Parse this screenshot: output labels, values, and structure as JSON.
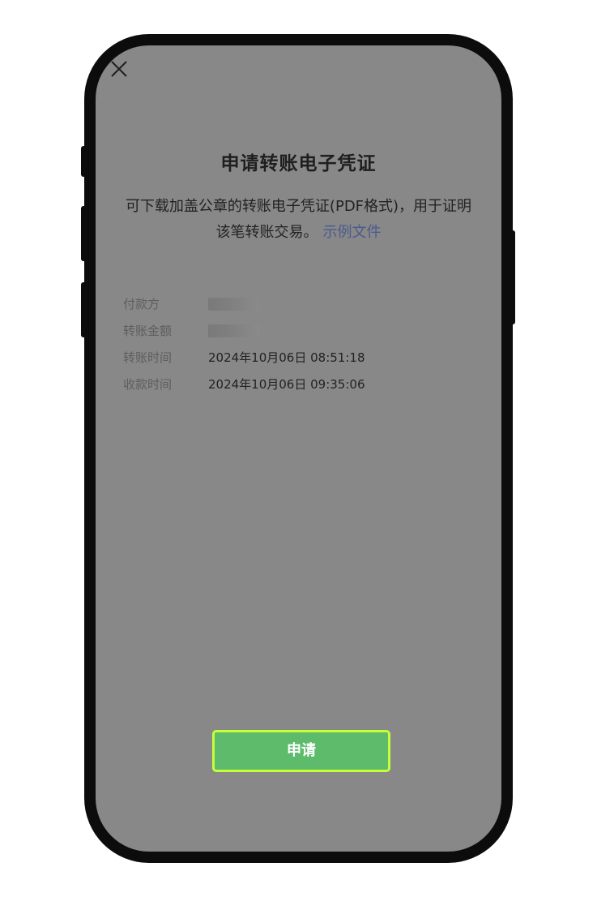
{
  "header": {
    "close_icon": "close-icon"
  },
  "main": {
    "title": "申请转账电子凭证",
    "description": "可下载加盖公章的转账电子凭证(PDF格式)，用于证明该笔转账交易。",
    "sample_link": "示例文件"
  },
  "details": {
    "payer_label": "付款方",
    "amount_label": "转账金额",
    "transfer_time_label": "转账时间",
    "transfer_time_value": "2024年10月06日 08:51:18",
    "receive_time_label": "收款时间",
    "receive_time_value": "2024年10月06日 09:35:06"
  },
  "footer": {
    "apply_label": "申请"
  },
  "colors": {
    "screen_overlay": "#888888",
    "button_green": "#5dbb6b",
    "button_highlight": "#c6ff3a",
    "link": "#4a5a8c"
  }
}
